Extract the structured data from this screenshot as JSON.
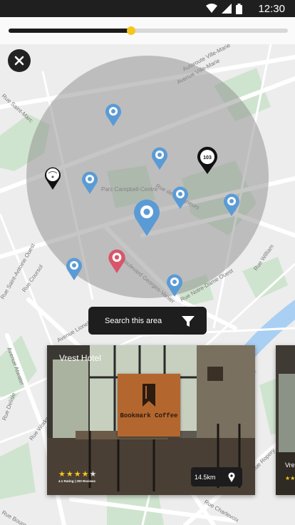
{
  "status_bar": {
    "time": "12:30"
  },
  "radius_slider": {
    "value": 0.44
  },
  "search": {
    "label": "Search this area"
  },
  "map": {
    "streets": [
      "Avenue Ville-Marie",
      "Autoroute Ville-Marie",
      "Rue Saint-Marc",
      "Rue Saint-Antoine Ouest",
      "Rue Coursol",
      "Avenue Lionel-Groulx",
      "Avenue Atwater",
      "Rue Delisle",
      "Rue Workman",
      "Rue Bourget",
      "Rue des Seigneurs",
      "Boulevard Georges-Vanier",
      "Rue Notre-Dame Ouest",
      "Rue William",
      "Rue Ropery",
      "Rue Charlevoix",
      "Parc Campbell-Centre",
      "103"
    ]
  },
  "cards": [
    {
      "title": "Vrest Hotel",
      "sign": "Bookmark Coffee",
      "rating": 4,
      "max_rating": 5,
      "rating_text": "4.1 Rating | 200 Reviews",
      "distance": "14.5km"
    },
    {
      "title": "Vre",
      "rating_stars": "★★"
    }
  ]
}
